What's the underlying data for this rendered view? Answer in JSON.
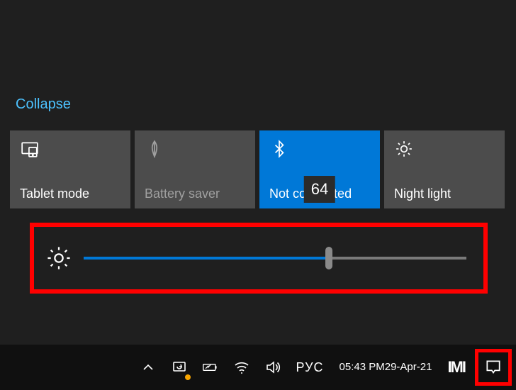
{
  "collapse_label": "Collapse",
  "tiles": [
    {
      "label": "Tablet mode",
      "icon": "tablet-mode-icon",
      "active": false,
      "dim": false
    },
    {
      "label": "Battery saver",
      "icon": "battery-saver-icon",
      "active": false,
      "dim": true
    },
    {
      "label": "Not connected",
      "icon": "bluetooth-icon",
      "active": true,
      "dim": false
    },
    {
      "label": "Night light",
      "icon": "night-light-icon",
      "active": false,
      "dim": false
    }
  ],
  "brightness": {
    "value": 64,
    "tooltip": "64"
  },
  "taskbar": {
    "language": "РУС",
    "time": "05:43 PM",
    "date": "29-Apr-21",
    "logo": "IMI"
  },
  "colors": {
    "accent": "#0078d7",
    "highlight_box": "#ff0000"
  }
}
